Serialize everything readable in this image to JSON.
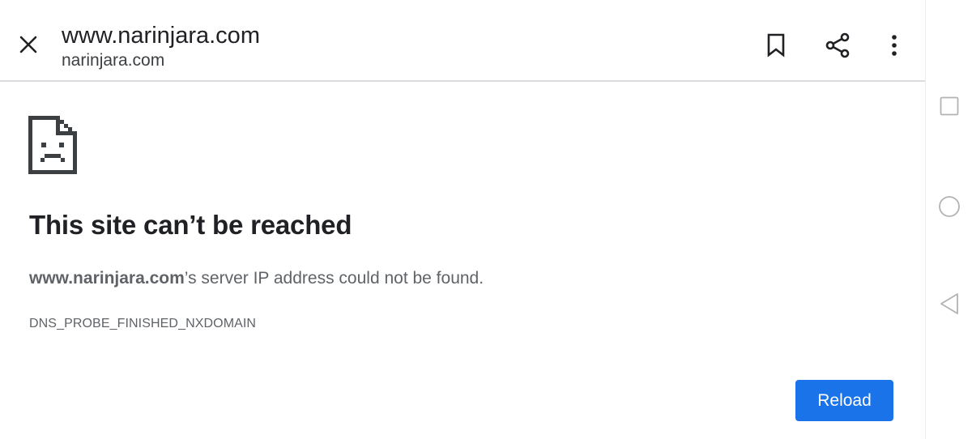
{
  "toolbar": {
    "title": "www.narinjara.com",
    "url": "narinjara.com",
    "icons": {
      "close": "close-icon",
      "bookmark": "bookmark-icon",
      "share": "share-icon",
      "more": "more-vert-icon"
    }
  },
  "error_page": {
    "icon": "sad-page-icon",
    "heading": "This site can’t be reached",
    "message_host": "www.narinjara.com",
    "message_rest": "’s server IP address could not be found.",
    "error_code": "DNS_PROBE_FINISHED_NXDOMAIN",
    "reload_label": "Reload"
  },
  "system_nav": {
    "recent": "recent-apps-icon",
    "home": "home-icon",
    "back": "back-icon"
  },
  "colors": {
    "accent": "#1a73e8",
    "text_primary": "#202124",
    "text_secondary": "#5f6368",
    "divider": "#dadce0"
  }
}
